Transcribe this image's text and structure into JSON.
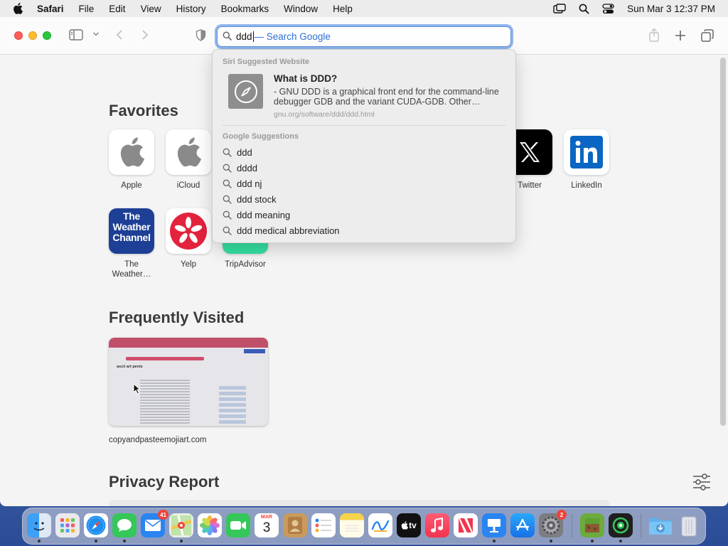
{
  "menubar": {
    "app_name": "Safari",
    "items": [
      "File",
      "Edit",
      "View",
      "History",
      "Bookmarks",
      "Window",
      "Help"
    ],
    "clock": "Sun Mar 3  12:37 PM"
  },
  "address_bar": {
    "typed": "ddd",
    "completion_hint": "— Search Google"
  },
  "favorites": {
    "heading": "Favorites",
    "items": [
      {
        "label": "Apple"
      },
      {
        "label": "iCloud"
      },
      {
        "label": "Twitter"
      },
      {
        "label": "LinkedIn"
      },
      {
        "label": "The Weather…",
        "tile_text": "The Weather Channel"
      },
      {
        "label": "Yelp"
      },
      {
        "label": "TripAdvisor"
      }
    ]
  },
  "frequently_visited": {
    "heading": "Frequently Visited",
    "items": [
      {
        "caption": "copyandpasteemojiart.com",
        "thumb_title": "ascii art penis"
      }
    ]
  },
  "privacy_report": {
    "heading": "Privacy Report"
  },
  "dropdown": {
    "siri_heading": "Siri Suggested Website",
    "siri_title": "What is DDD?",
    "siri_description": "- GNU DDD is a graphical front end for the command-line debugger GDB and the variant CUDA-GDB. Other…",
    "siri_url": "gnu.org/software/ddd/ddd.html",
    "google_heading": "Google Suggestions",
    "suggestions": [
      "ddd",
      "dddd",
      "ddd nj",
      "ddd stock",
      "ddd meaning",
      "ddd medical abbreviation"
    ]
  },
  "dock": {
    "mail_badge": "41",
    "settings_badge": "2",
    "calendar_month": "MAR",
    "calendar_day": "3",
    "tv_label": "tv"
  },
  "colors": {
    "accent": "#2b6fd6",
    "linkedin": "#0a66c2",
    "weather": "#1d3f95",
    "yelp": "#e3233d"
  }
}
